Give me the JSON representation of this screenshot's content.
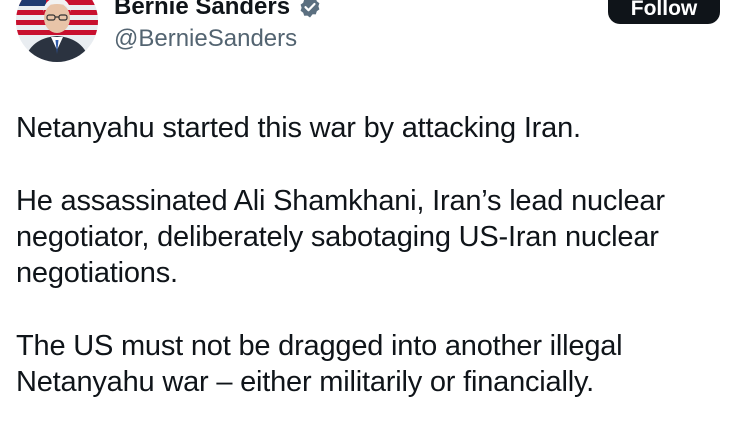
{
  "author": {
    "display_name": "Bernie Sanders",
    "handle": "@BernieSanders",
    "verified_icon": "verified-badge-icon",
    "avatar_icon": "profile-photo"
  },
  "actions": {
    "follow_label": "Follow"
  },
  "tweet": {
    "paragraphs": [
      "Netanyahu started this war by attacking Iran.",
      "He assassinated Ali Shamkhani, Iran’s lead nuclear\nnegotiator, deliberately sabotaging US-Iran nuclear\nnegotiations.",
      "The US must not be dragged into another illegal\nNetanyahu war – either militarily or financially."
    ]
  },
  "colors": {
    "text_primary": "#0f1419",
    "text_secondary": "#536471",
    "button_bg": "#0f1419",
    "verified": "#5b6f80"
  }
}
